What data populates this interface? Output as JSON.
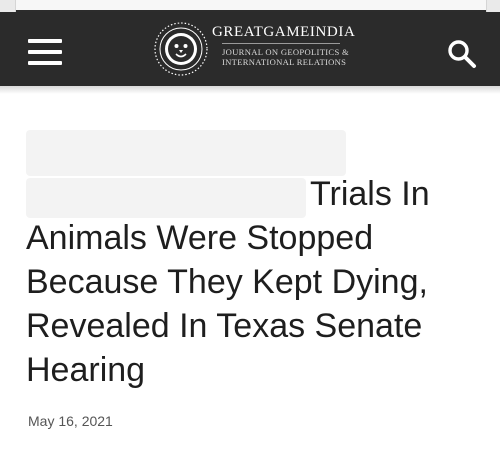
{
  "site": {
    "name": "GREATGAMEINDIA",
    "tagline": "Journal on Geopolitics & International Relations"
  },
  "header": {
    "menu_icon": "hamburger-menu-icon",
    "search_icon": "search-icon",
    "background_color": "#2b2b2b"
  },
  "article": {
    "title_visible": "Trials In Animals Were Stopped Because They Kept Dying, Revealed In Texas Senate Hearing",
    "date": "May 16, 2021"
  }
}
